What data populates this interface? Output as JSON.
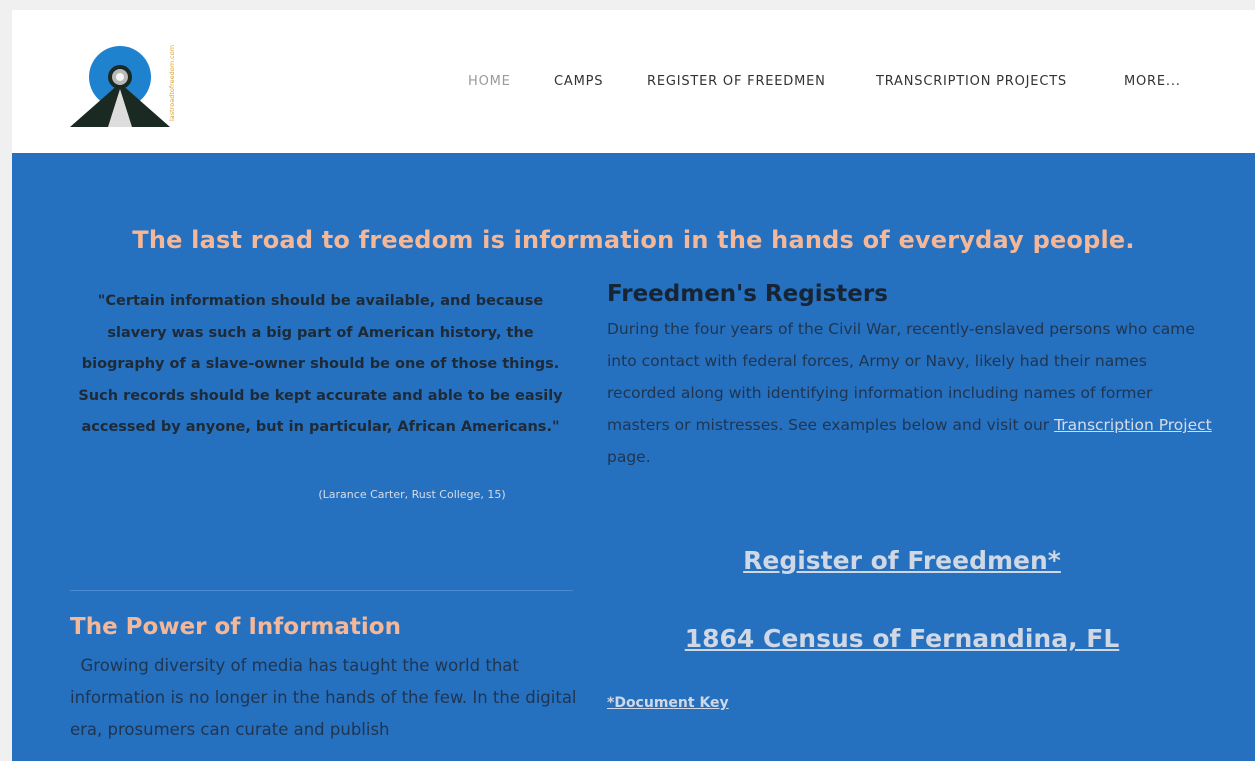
{
  "nav": {
    "items": [
      {
        "label": "HOME"
      },
      {
        "label": "CAMPS"
      },
      {
        "label": "REGISTER OF FREEDMEN"
      },
      {
        "label": "TRANSCRIPTION PROJECTS"
      },
      {
        "label": "MORE..."
      }
    ]
  },
  "logo": {
    "icon": "road-logo-icon",
    "text": "lastroadtofreedom.com"
  },
  "colors": {
    "header_bg": "#ffffff",
    "main_bg": "#2670c0",
    "accent_peach": "#f4b898",
    "dark_text": "#162434",
    "link_text": "#cfd8e4"
  },
  "hero": {
    "tagline": "The last road to freedom is information in the hands of everyday people."
  },
  "quote": {
    "text": "\"Certain information should be available, and because slavery was such a big part of American history, the biography of a slave-owner should be one of those things. Such records should be kept accurate and able to be easily accessed by anyone, but in particular, African Americans.\"",
    "attribution": "(Larance Carter, Rust College, 15)"
  },
  "power": {
    "heading": "The Power of Information",
    "body": "Growing diversity of media has taught the world that information is no longer in the hands of the few. In the digital era, prosumers can curate and publish"
  },
  "registers": {
    "heading": "Freedmen's Registers",
    "body_before": "During the four years of the Civil War, recently-enslaved persons who came into contact with federal forces, Army or Navy, likely had their names recorded along with identifying information including names of former masters or mistresses. See examples below and visit our ",
    "link": "Transcription Project",
    "body_after": " page."
  },
  "links": {
    "register": "Register of Freedmen*",
    "census": "1864 Census of Fernandina, FL",
    "doc_key": "*Document Key"
  }
}
